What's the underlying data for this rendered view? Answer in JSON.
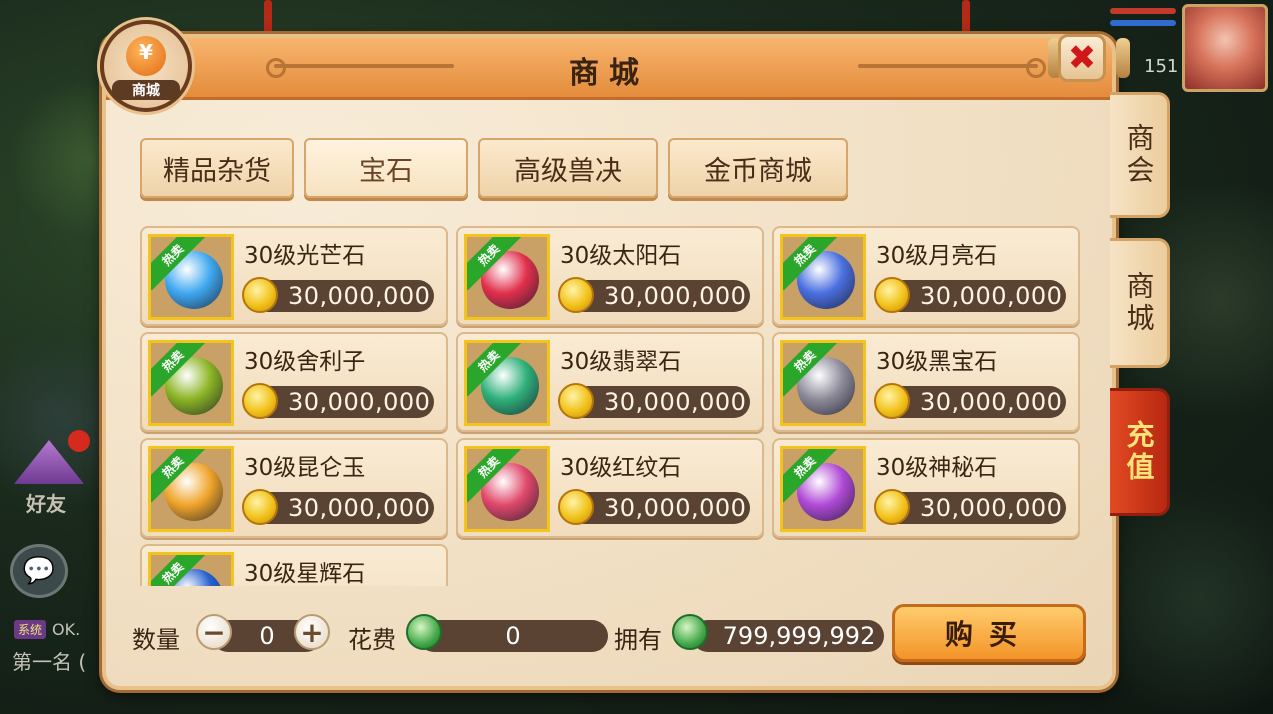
{
  "window": {
    "title": "商城",
    "badge_label": "商城",
    "badge_symbol": "¥",
    "close_symbol": "✖"
  },
  "hud": {
    "level": "151",
    "friend_label": "好友",
    "sys_tag": "系统",
    "sys_text": "OK.",
    "rank_text": "第一名 ("
  },
  "tabs": [
    {
      "label": "精品杂货",
      "active": false
    },
    {
      "label": "宝石",
      "active": true
    },
    {
      "label": "高级兽决",
      "active": false
    },
    {
      "label": "金币商城",
      "active": false
    }
  ],
  "side_tabs": [
    {
      "label": "商会"
    },
    {
      "label": "商城"
    },
    {
      "label": "充值"
    }
  ],
  "hot_label": "热卖",
  "items": [
    {
      "name": "30级光芒石",
      "price": "30,000,000",
      "icon": "blue-crystal-gem-icon",
      "color": "#3fa8f0"
    },
    {
      "name": "30级太阳石",
      "price": "30,000,000",
      "icon": "red-swirl-gem-icon",
      "color": "#e2304d"
    },
    {
      "name": "30级月亮石",
      "price": "30,000,000",
      "icon": "crescent-moon-gem-icon",
      "color": "#4a6fe0"
    },
    {
      "name": "30级舍利子",
      "price": "30,000,000",
      "icon": "green-beads-gem-icon",
      "color": "#8bb424"
    },
    {
      "name": "30级翡翠石",
      "price": "30,000,000",
      "icon": "jade-orb-gem-icon",
      "color": "#2fb07a"
    },
    {
      "name": "30级黑宝石",
      "price": "30,000,000",
      "icon": "black-diamond-gem-icon",
      "color": "#8d8b9a"
    },
    {
      "name": "30级昆仑玉",
      "price": "30,000,000",
      "icon": "amber-jade-gem-icon",
      "color": "#f0a42a"
    },
    {
      "name": "30级红纹石",
      "price": "30,000,000",
      "icon": "red-pattern-gem-icon",
      "color": "#e0486a"
    },
    {
      "name": "30级神秘石",
      "price": "30,000,000",
      "icon": "purple-mystic-gem-icon",
      "color": "#b04ad6"
    },
    {
      "name": "30级星辉石",
      "price": "",
      "icon": "star-blue-gem-icon",
      "color": "#2660d0"
    }
  ],
  "purchase": {
    "qty_label": "数量",
    "qty_value": "0",
    "minus": "−",
    "plus": "+",
    "cost_label": "花费",
    "cost_value": "0",
    "own_label": "拥有",
    "own_value": "799,999,992",
    "buy_label": "购买"
  }
}
